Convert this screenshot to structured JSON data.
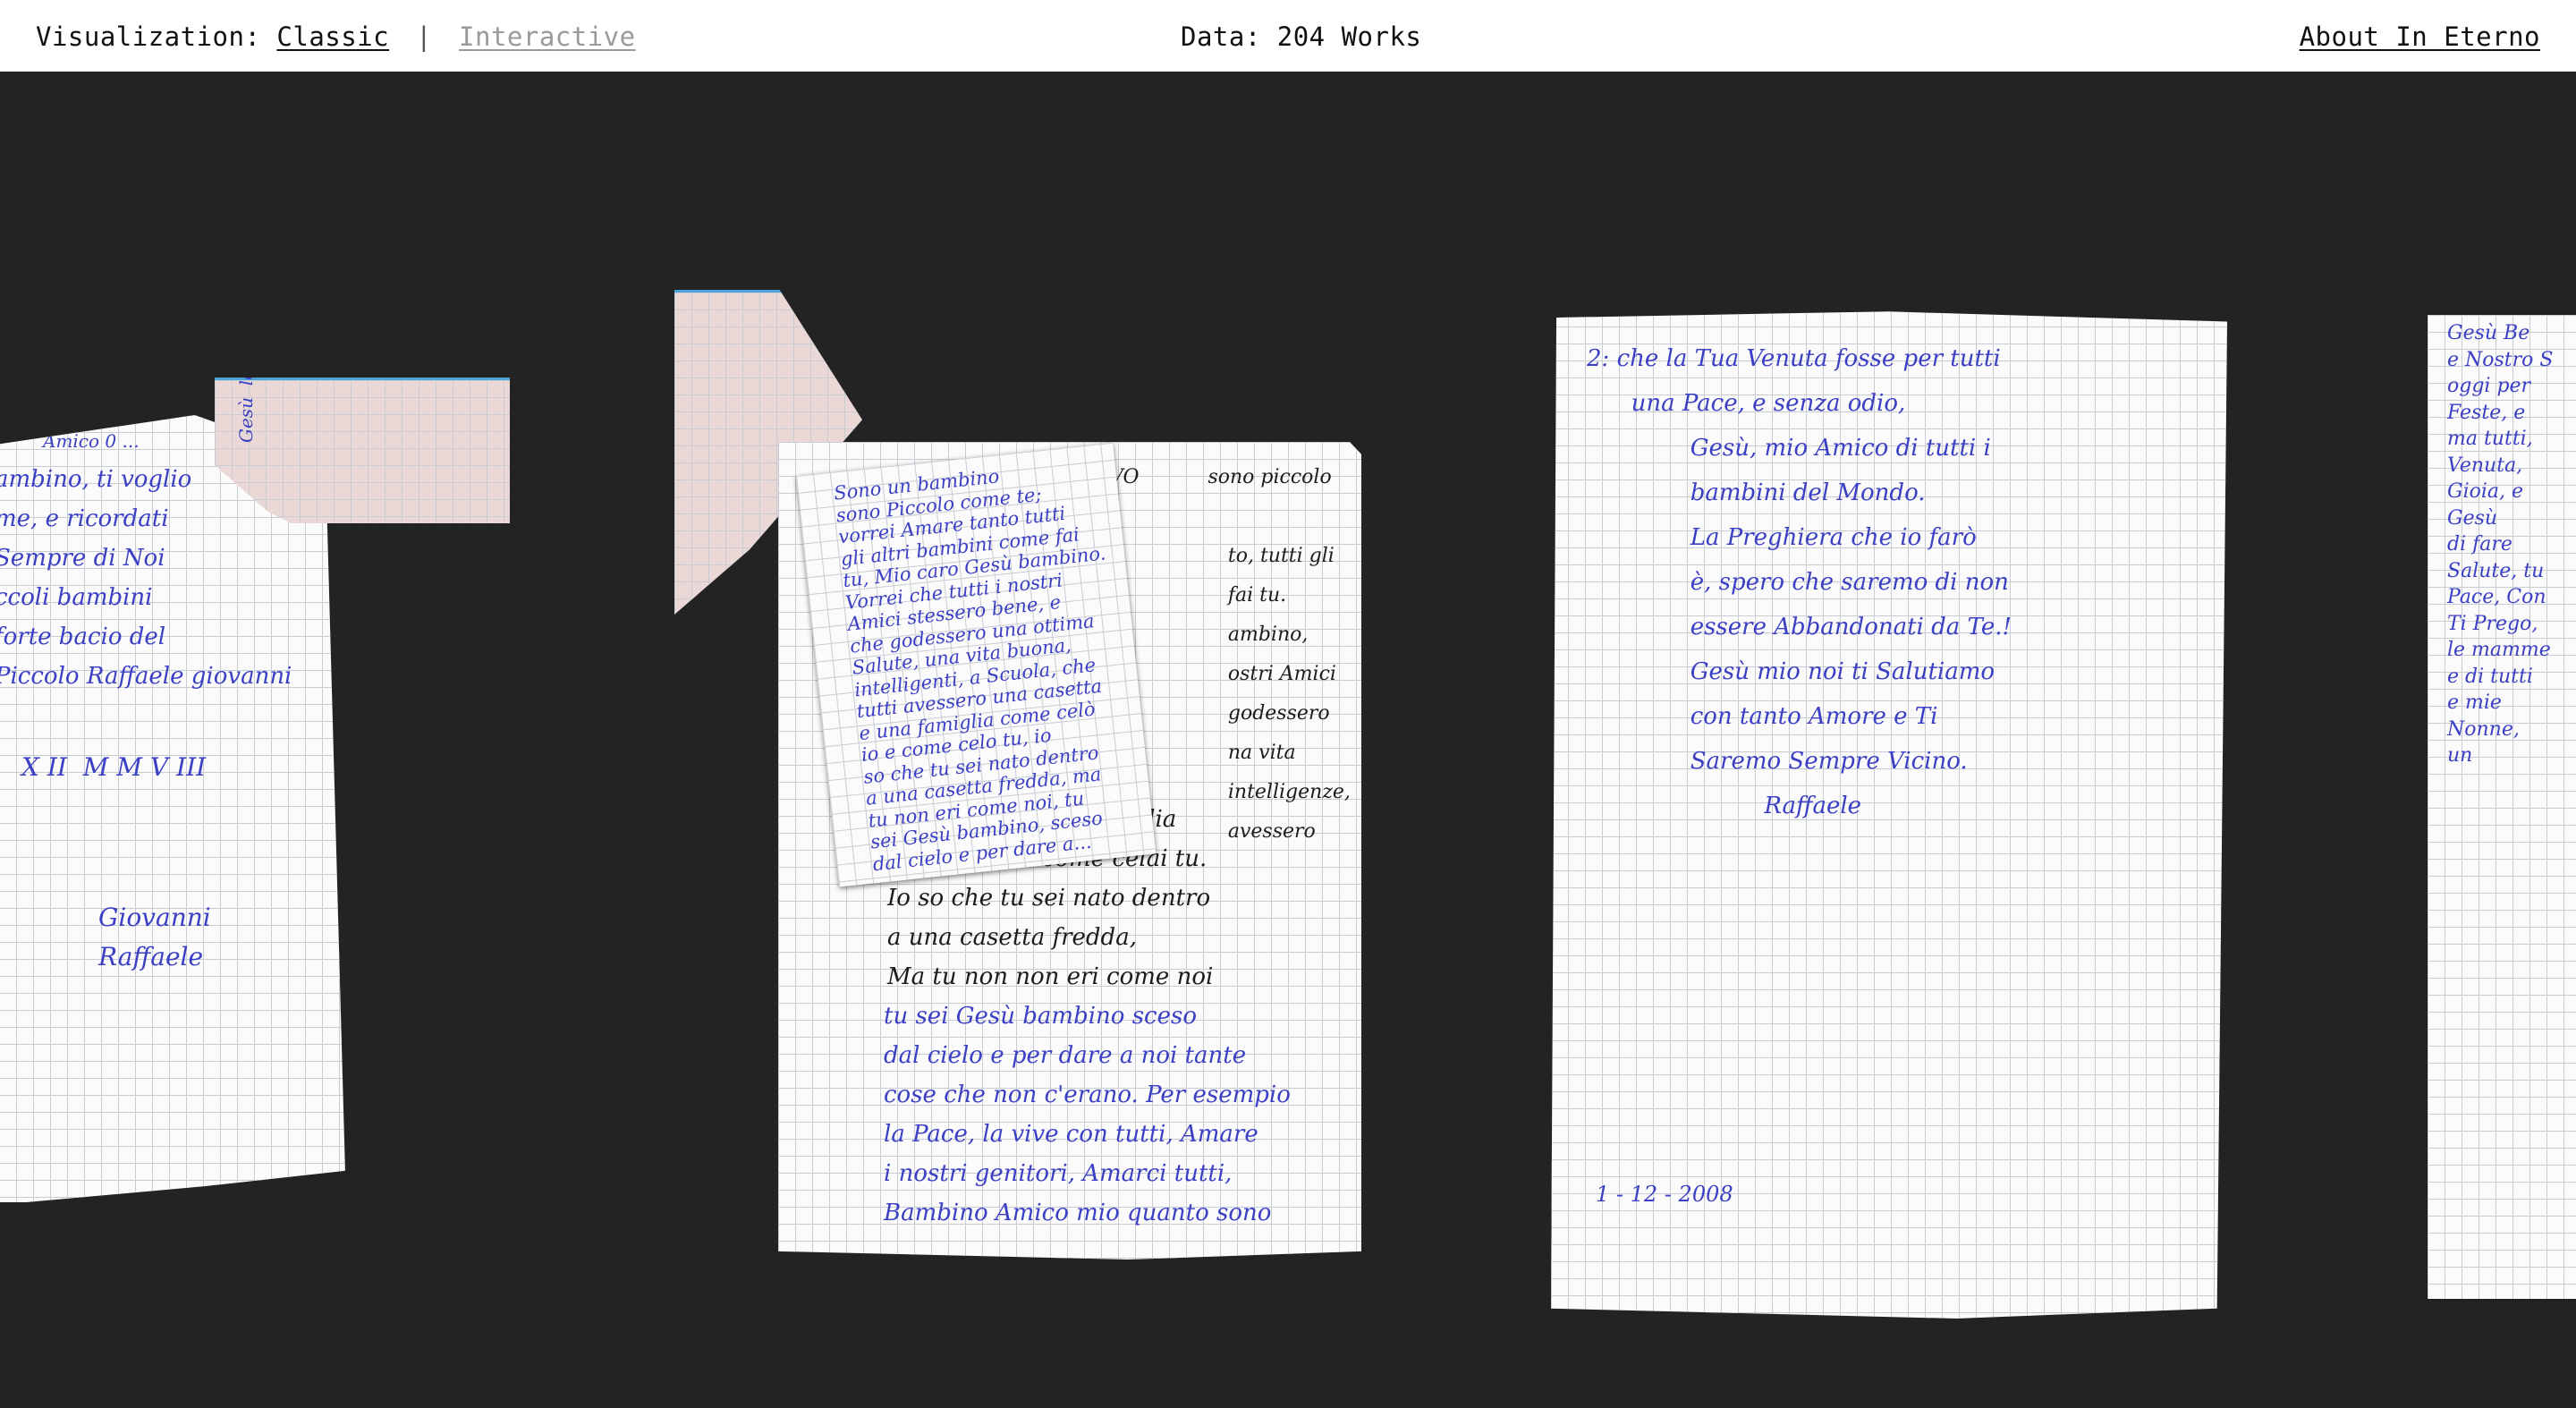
{
  "header": {
    "visualization_label": "Visualization:",
    "classic": "Classic",
    "separator": "|",
    "interactive": "Interactive",
    "data_count": "Data: 204 Works",
    "about": "About In Eterno"
  },
  "letters": {
    "letter1": {
      "top_line": "Amico 0 ...",
      "body": "ambino, ti voglio\nme, e ricordati\nSempre di Noi\nccoli bambini\nforte bacio del\nPiccolo Raffaele giovanni",
      "date": "X II  M M V III",
      "signature": "Giovanni\nRaffaele",
      "strip_text": "Gesù  loro"
    },
    "letter2": {
      "overlay": "Sono un bambino\nsono Piccolo come te;\nvorrei Amare tanto tutti\ngli altri bambini come fai\ntu, Mio caro Gesù bambino.\nVorrei che tutti i nostri\nAmici stessero bene, e\nche godessero una ottima\nSalute, una vita buona,\nintelligenti, a Scuola, che\ntutti avessero una casetta\ne una famiglia come celò\nio e come celo tu, io\nso che tu sei nato dentro\na una casetta fredda, ma\ntu non eri come noi, tu\nsei Gesù bambino, sceso\ndal cielo e per dare a...",
      "under_fragments": "VO           sono piccolo\n\n                   to, tutti gli\n                   fai tu.\n                   ambino,\n                   ostri Amici\n                   godessero\n                   na vita\n                   intelligenze,\n                   avessero",
      "body_black": "a casetta, e una famiglia\ncome celò io come celai tu.\nIo so che tu sei nato dentro\na una casetta fredda,\nMa tu non non eri come noi",
      "body_blue": "tu sei Gesù bambino sceso\ndal cielo e per dare a noi tante\ncose che non c'erano. Per esempio\nla Pace, la vive con tutti, Amare\ni nostri genitori, Amarci tutti,\nBambino Amico mio quanto sono"
    },
    "letter3": {
      "body": "2: che la Tua Venuta fosse per tutti\n      una Pace, e senza odio,\n              Gesù, mio Amico di tutti i\n              bambini del Mondo.\n              La Preghiera che io farò\n              è, spero che saremo di non\n              essere Abbandonati da Te.!\n              Gesù mio noi ti Salutiamo\n              con tanto Amore e Ti\n              Saremo Sempre Vicino.\n                        Raffaele",
      "date": "1 - 12 - 2008"
    },
    "letter4": {
      "body": "Gesù Be\ne Nostro S\noggi per\nFeste, e\nma tutti,\nVenuta,\nGioia, e\nGesù\ndi fare\nSalute, tu\nPace, Con\nTi Prego,\nle mamme\ne di tutti\ne mie\nNonne,\nun"
    }
  }
}
